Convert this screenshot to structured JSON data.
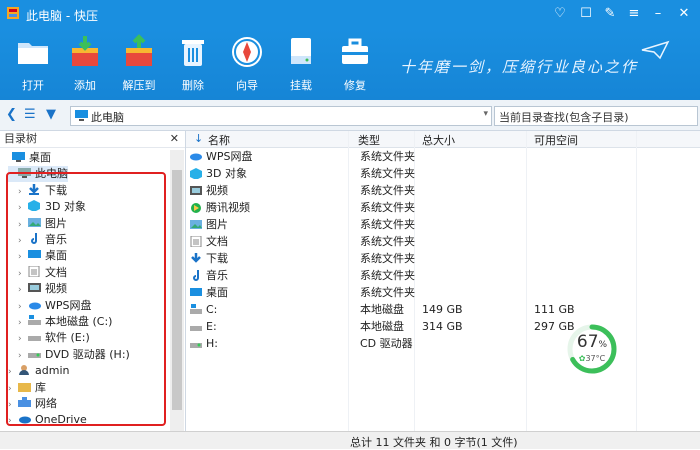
{
  "window": {
    "title": "此电脑 - 快压"
  },
  "toolbar": {
    "open": "打开",
    "add": "添加",
    "extract": "解压到",
    "delete": "删除",
    "wizard": "向导",
    "mount": "挂载",
    "repair": "修复",
    "slogan": "十年磨一剑，压缩行业良心之作"
  },
  "address": {
    "path": "此电脑",
    "search_placeholder": "当前目录查找(包含子目录)"
  },
  "tree": {
    "header": "目录树",
    "items": [
      {
        "label": "桌面",
        "level": 0
      },
      {
        "label": "此电脑",
        "level": 1
      },
      {
        "label": "下载",
        "level": 2
      },
      {
        "label": "3D 对象",
        "level": 2
      },
      {
        "label": "图片",
        "level": 2
      },
      {
        "label": "音乐",
        "level": 2
      },
      {
        "label": "桌面",
        "level": 2
      },
      {
        "label": "文档",
        "level": 2
      },
      {
        "label": "视频",
        "level": 2
      },
      {
        "label": "WPS网盘",
        "level": 2
      },
      {
        "label": "本地磁盘 (C:)",
        "level": 2
      },
      {
        "label": "软件 (E:)",
        "level": 2
      },
      {
        "label": "DVD 驱动器 (H:)",
        "level": 2
      },
      {
        "label": "admin",
        "level": 1
      },
      {
        "label": "库",
        "level": 1
      },
      {
        "label": "网络",
        "level": 1
      },
      {
        "label": "OneDrive",
        "level": 1
      }
    ]
  },
  "list": {
    "headers": {
      "name": "名称",
      "type": "类型",
      "total": "总大小",
      "free": "可用空间"
    },
    "rows": [
      {
        "name": "WPS网盘",
        "type": "系统文件夹",
        "total": "",
        "free": ""
      },
      {
        "name": "3D 对象",
        "type": "系统文件夹",
        "total": "",
        "free": ""
      },
      {
        "name": "视频",
        "type": "系统文件夹",
        "total": "",
        "free": ""
      },
      {
        "name": "腾讯视频",
        "type": "系统文件夹",
        "total": "",
        "free": ""
      },
      {
        "name": "图片",
        "type": "系统文件夹",
        "total": "",
        "free": ""
      },
      {
        "name": "文档",
        "type": "系统文件夹",
        "total": "",
        "free": ""
      },
      {
        "name": "下载",
        "type": "系统文件夹",
        "total": "",
        "free": ""
      },
      {
        "name": "音乐",
        "type": "系统文件夹",
        "total": "",
        "free": ""
      },
      {
        "name": "桌面",
        "type": "系统文件夹",
        "total": "",
        "free": ""
      },
      {
        "name": "C:",
        "type": "本地磁盘",
        "total": "149 GB",
        "free": "111 GB"
      },
      {
        "name": "E:",
        "type": "本地磁盘",
        "total": "314 GB",
        "free": "297 GB"
      },
      {
        "name": "H:",
        "type": "CD 驱动器",
        "total": "",
        "free": ""
      }
    ]
  },
  "gauge": {
    "percent": "67",
    "percent_sign": "%",
    "temp": "37°C",
    "value": 0.67
  },
  "status": {
    "text": "总计 11 文件夹 和 0 字节(1 文件)"
  },
  "colors": {
    "brand": "#1a8fe0",
    "highlight": "#e02020",
    "gauge": "#3cbf5a"
  }
}
